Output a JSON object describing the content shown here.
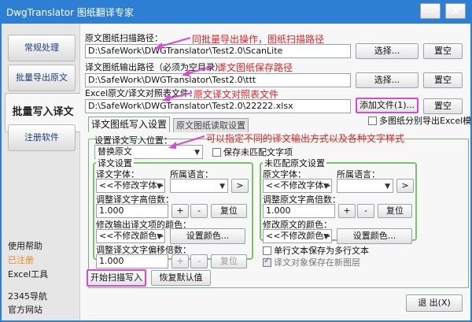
{
  "window": {
    "title": "DwgTranslator 图纸翻译专家",
    "minimize_icon": "—",
    "close_icon": "✕"
  },
  "sidebar": {
    "nav": [
      {
        "label": "常规处理"
      },
      {
        "label": "批量导出原文"
      },
      {
        "label": "批量写入译文"
      },
      {
        "label": "注册软件"
      }
    ],
    "links": [
      {
        "label": "使用帮助"
      },
      {
        "label": "已注册"
      },
      {
        "label": "Excel工具"
      },
      {
        "label": "2345导航"
      },
      {
        "label": "官方网站"
      }
    ]
  },
  "main": {
    "scan_path_label": "原文图纸扫描路径：",
    "scan_path_value": "D:\\SafeWork\\DWGTranslator\\Test2.0\\ScanLite",
    "output_path_label": "译文图纸输出路径（必须为空目录）：",
    "output_path_value": "D:\\SafeWork\\DWGTranslator\\Test2.0\\ttt",
    "excel_label": "Excel原文/译文对照表文件：",
    "excel_value": "D:\\SafeWork\\DWGTranslator\\Test2.0\\22222.xlsx",
    "browse_label": "选择...",
    "clear_label": "置空",
    "add_file_label": "添加文件(1)...",
    "multi_sheet_label": "多图纸分别导出Excel模式"
  },
  "tabs": [
    {
      "label": "译文图纸写入设置"
    },
    {
      "label": "原文图纸读取设置"
    }
  ],
  "settings": {
    "write_pos_label": "设置译文写入位置：",
    "write_pos_value": "替换原文",
    "keep_unmatched_label": "保存未匹配文字项",
    "trans_group": {
      "title": "译文设置",
      "font_label": "译文字体：",
      "layer_lang_label": "所属语言：",
      "font_value": "<<不修改字体>>",
      "lang_value": "",
      "height_label": "调整译文字高倍数：",
      "height_value": "1.000",
      "color_label": "修改输出译文项的颜色：",
      "color_value": "<<不修改颜色>>",
      "set_color_label": "设置颜色...",
      "offset_label": "调整译文文字偏移倍数：",
      "offset_value": "1.000",
      "reset_label": "复位",
      "plus": "+",
      "minus": "-",
      "more": ">"
    },
    "unmatched_group": {
      "title": "未匹配原文设置",
      "font_label": "原文字体：",
      "layer_lang_label": "所属语言：",
      "font_value": "<<不修改字体>>",
      "lang_value": "",
      "height_label": "调整原文字高倍数：",
      "height_value": "1.000",
      "color_label": "修改原文的颜色：",
      "color_value": "<<不修改颜色>>",
      "set_color_label": "设置颜色...",
      "reset_label": "复位",
      "plus": "+",
      "minus": "-",
      "more": ">"
    },
    "single_line_label": "单行文本保存为多行文本",
    "new_layer_label": "译文对象保存在新图层"
  },
  "actions": {
    "start_label": "开始扫描写入",
    "restore_label": "恢复默认值",
    "exit_label": "退 出(X)"
  },
  "annotations": {
    "a1": "同批量导出操作，图纸扫描路径",
    "a2": "译文图纸保存路径",
    "a3": "原文译文对照表文件",
    "a4": "可以指定不同的译文输出方式以及各种文字样式"
  },
  "colors": {
    "title_bar": "#2d7fd3",
    "accent_green": "#79c36a",
    "annotation_red": "#e0262a",
    "highlight_magenta": "#d94ad4"
  }
}
